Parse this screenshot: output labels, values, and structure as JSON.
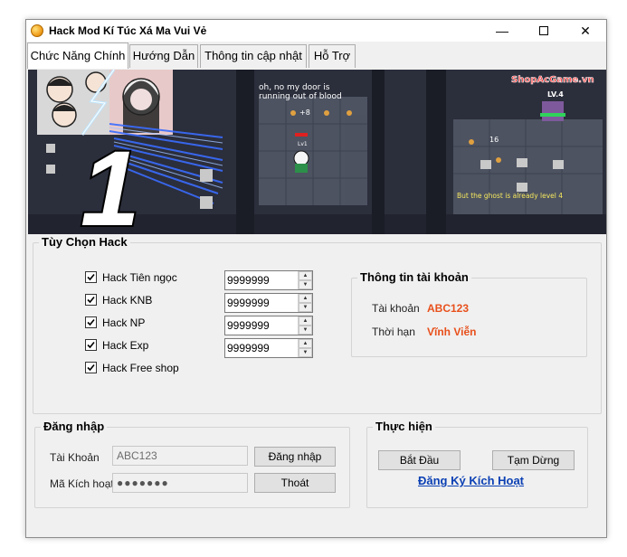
{
  "window": {
    "title": "Hack Mod Kí Túc Xá Ma Vui Vẻ",
    "minimize_glyph": "—",
    "close_glyph": "✕"
  },
  "tabs": [
    {
      "label": "Chức Năng Chính",
      "active": true
    },
    {
      "label": "Hướng Dẫn",
      "active": false
    },
    {
      "label": "Thông tin cập nhật",
      "active": false
    },
    {
      "label": "Hỗ Trợ",
      "active": false
    }
  ],
  "banner": {
    "big_number": "1",
    "speech_1": "oh, no my door is",
    "speech_2": "running out of blood",
    "level_badge": "LV.4",
    "brand": "ShopAcGame.vn",
    "caption": "But the ghost is already level 4",
    "counter_1": "+8",
    "counter_2": "16",
    "player_tag": "Lv1"
  },
  "hack_options": {
    "title": "Tùy Chọn Hack",
    "items": [
      {
        "label": "Hack Tiên ngọc",
        "checked": true,
        "value": "9999999"
      },
      {
        "label": "Hack KNB",
        "checked": true,
        "value": "9999999"
      },
      {
        "label": "Hack NP",
        "checked": true,
        "value": "9999999"
      },
      {
        "label": "Hack Exp",
        "checked": true,
        "value": "9999999"
      },
      {
        "label": "Hack Free shop",
        "checked": true
      }
    ]
  },
  "account_info": {
    "title": "Thông tin tài khoản",
    "account_label": "Tài khoản",
    "account_value": "ABC123",
    "duration_label": "Thời hạn",
    "duration_value": "Vĩnh Viễn"
  },
  "login": {
    "title": "Đăng nhập",
    "account_label": "Tài Khoản",
    "account_value": "ABC123",
    "code_label": "Mã Kích hoạt",
    "code_value": "●●●●●●●",
    "login_button": "Đăng nhập",
    "exit_button": "Thoát"
  },
  "execute": {
    "title": "Thực hiện",
    "start_button": "Bắt Đầu",
    "pause_button": "Tạm Dừng",
    "register_link": "Đăng Ký Kích Hoạt"
  },
  "colors": {
    "accent_value": "#e8501c",
    "link": "#0b40b4"
  }
}
